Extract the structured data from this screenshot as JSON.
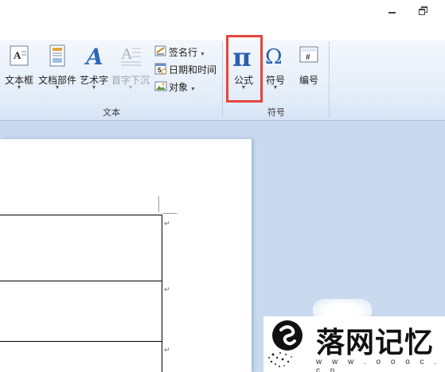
{
  "window": {
    "minimize_label": "minimize",
    "restore_label": "restore"
  },
  "ribbon": {
    "text_group": {
      "label": "文本",
      "buttons": [
        {
          "label": "文本框",
          "icon": "text-box-icon"
        },
        {
          "label": "文档部件",
          "icon": "document-parts-icon"
        },
        {
          "label": "艺术字",
          "icon": "wordart-icon"
        },
        {
          "label": "首字下沉",
          "icon": "drop-cap-icon",
          "disabled": true
        }
      ],
      "small_buttons": [
        {
          "label": "签名行",
          "icon": "signature-line-icon",
          "has_dropdown": true
        },
        {
          "label": "日期和时间",
          "icon": "date-time-icon",
          "has_dropdown": false
        },
        {
          "label": "对象",
          "icon": "object-icon",
          "has_dropdown": true
        }
      ]
    },
    "symbols_group": {
      "label": "符号",
      "buttons": [
        {
          "label": "公式",
          "icon": "pi-equation-icon",
          "glyph": "π"
        },
        {
          "label": "符号",
          "icon": "omega-symbol-icon",
          "glyph": "Ω"
        },
        {
          "label": "编号",
          "icon": "number-icon",
          "glyph": "#"
        }
      ]
    },
    "highlight_color": "#e4463d"
  },
  "document": {
    "paragraph_mark": "↵"
  },
  "watermark": {
    "text": "落网记忆",
    "url": "w w w . o o o c . c n"
  }
}
